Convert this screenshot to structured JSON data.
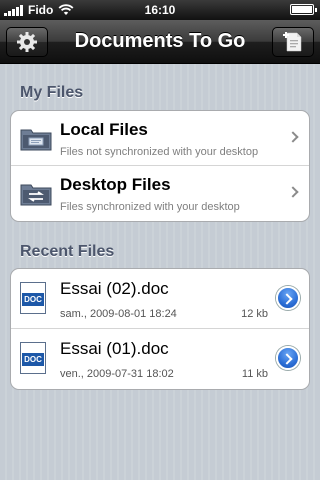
{
  "status_bar": {
    "carrier": "Fido",
    "time": "16:10",
    "battery_level": 1.0
  },
  "nav": {
    "title": "Documents To Go",
    "left_icon": "gear-icon",
    "right_icon": "new-document-icon"
  },
  "my_files": {
    "header": "My Files",
    "items": [
      {
        "title": "Local Files",
        "subtitle": "Files not synchronized with your desktop",
        "icon": "folder-icon"
      },
      {
        "title": "Desktop Files",
        "subtitle": "Files synchronized with your desktop",
        "icon": "sync-folder-icon"
      }
    ]
  },
  "recent_files": {
    "header": "Recent Files",
    "items": [
      {
        "name": "Essai (02).doc",
        "date": "sam., 2009-08-01 18:24",
        "size": "12 kb",
        "badge": "DOC"
      },
      {
        "name": "Essai (01).doc",
        "date": "ven., 2009-07-31 18:02",
        "size": "11 kb",
        "badge": "DOC"
      }
    ]
  }
}
